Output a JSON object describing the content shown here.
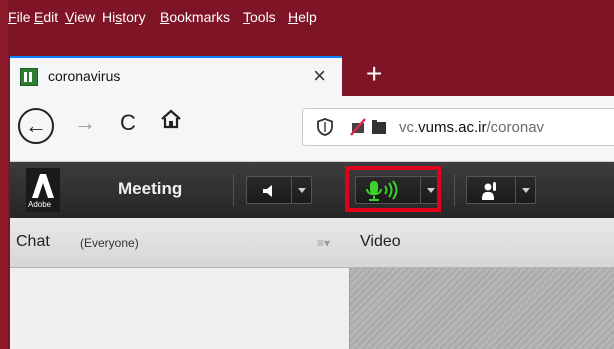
{
  "menubar": {
    "items": [
      {
        "label": "File",
        "mnemonic": "F",
        "rest": "ile"
      },
      {
        "label": "Edit",
        "mnemonic": "E",
        "rest": "dit"
      },
      {
        "label": "View",
        "mnemonic": "V",
        "rest": "iew"
      },
      {
        "label": "History",
        "pre": "Hi",
        "mnemonic": "s",
        "rest": "tory"
      },
      {
        "label": "Bookmarks",
        "mnemonic": "B",
        "rest": "ookmarks"
      },
      {
        "label": "Tools",
        "mnemonic": "T",
        "rest": "ools"
      },
      {
        "label": "Help",
        "mnemonic": "H",
        "rest": "elp"
      }
    ]
  },
  "tab": {
    "title": "coronavirus",
    "close": "×"
  },
  "newtab": "+",
  "navbar": {
    "back": "←",
    "forward": "→",
    "reload": "C",
    "url_prefix": "vc.",
    "url_domain": "vums.ac.ir",
    "url_path": "/coronav"
  },
  "toolbar": {
    "brand": "Adobe",
    "meeting": "Meeting"
  },
  "chat": {
    "title": "Chat",
    "scope": "(Everyone)",
    "menu": "≡▾"
  },
  "video": {
    "title": "Video"
  },
  "colors": {
    "accent": "#0a84ff",
    "highlight": "#e0001b",
    "mic_active": "#3bd32b"
  }
}
